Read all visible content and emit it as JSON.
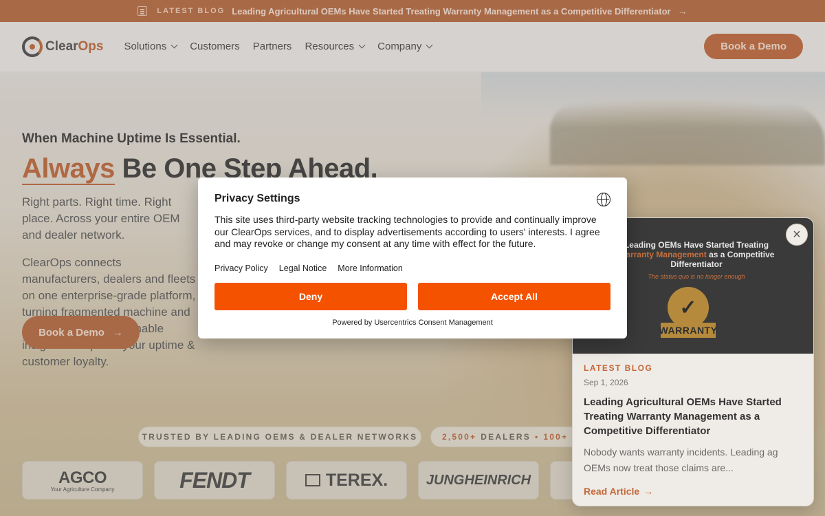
{
  "announcement": {
    "tag": "LATEST BLOG",
    "headline": "Leading Agricultural OEMs Have Started Treating Warranty Management as a Competitive Differentiator",
    "arrow": "→"
  },
  "nav": {
    "logo_text_a": "Clear",
    "logo_text_b": "Ops",
    "items": [
      {
        "label": "Solutions",
        "has_dropdown": true
      },
      {
        "label": "Customers",
        "has_dropdown": false
      },
      {
        "label": "Partners",
        "has_dropdown": false
      },
      {
        "label": "Resources",
        "has_dropdown": true
      },
      {
        "label": "Company",
        "has_dropdown": true
      }
    ],
    "cta": "Book a Demo"
  },
  "hero": {
    "kicker": "When Machine Uptime Is Essential.",
    "title_accent": "Always",
    "title_rest": " Be One Step Ahead.",
    "lede": "Right parts. Right time. Right place. Across your entire OEM and dealer network.",
    "body": "ClearOps connects manufacturers, dealers and fleets on one enterprise-grade platform, turning fragmented machine and service data into actionable insights to improve your uptime & customer loyalty.",
    "cta": "Book a Demo",
    "cta_arrow": "→"
  },
  "trust": {
    "trusted": "TRUSTED BY LEADING OEMS & DEALER NETWORKS",
    "stat1_num": "2,500+",
    "stat1_label": "DEALERS",
    "stat2_num": "100+"
  },
  "logos": {
    "agco": "AGCO",
    "agco_sub": "Your Agriculture Company",
    "fendt": "FENDT",
    "terex": "TEREX.",
    "jung": "JUNGHEINRICH"
  },
  "blog_card": {
    "thumb_title_a": "Leading OEMs Have Started Treating ",
    "thumb_title_hl": "Warranty Management",
    "thumb_title_b": " as a Competitive Differentiator",
    "thumb_sub": "The status quo is no longer enough",
    "badge_label": "WARRANTY",
    "close": "×",
    "tag": "LATEST BLOG",
    "date": "Sep 1, 2026",
    "title": "Leading Agricultural OEMs Have Started Treating Warranty Management as a Competitive Differentiator",
    "excerpt": "Nobody wants warranty incidents. Leading ag OEMs now treat those claims are...",
    "link": "Read Article",
    "link_arrow": "→"
  },
  "privacy_modal": {
    "title": "Privacy Settings",
    "text": "This site uses third-party website tracking technologies to provide and continually improve our ClearOps services, and to display advertisements according to users' interests. I agree and may revoke or change my consent at any time with effect for the future.",
    "links": [
      "Privacy Policy",
      "Legal Notice",
      "More Information"
    ],
    "deny": "Deny",
    "accept": "Accept All",
    "powered_by": "Powered by Usercentrics Consent Management"
  },
  "colors": {
    "brand": "#c2683a",
    "consent_button": "#f55200"
  }
}
